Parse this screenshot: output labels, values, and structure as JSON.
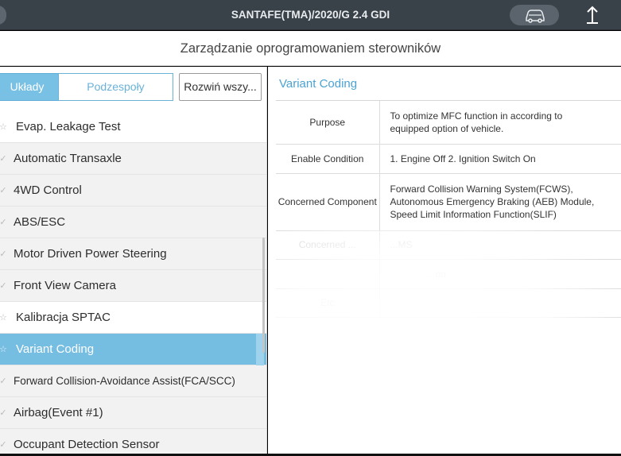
{
  "header": {
    "vehicle": "SANTAFE(TMA)/2020/G 2.4 GDI"
  },
  "subtitle": "Zarządzanie oprogramowaniem sterowników",
  "left_panel": {
    "segment_systems": "Układy",
    "segment_components": "Podzespoły",
    "expand_all": "Rozwiń wszy..."
  },
  "list": [
    {
      "label": "Evap. Leakage Test",
      "icon": "star-icon"
    },
    {
      "label": "Automatic Transaxle",
      "icon": "check-icon"
    },
    {
      "label": "4WD Control",
      "icon": "check-icon"
    },
    {
      "label": "ABS/ESC",
      "icon": "check-icon"
    },
    {
      "label": "Motor Driven Power Steering",
      "icon": "check-icon"
    },
    {
      "label": "Front View Camera",
      "icon": "check-icon"
    },
    {
      "label": "Kalibracja SPTAC",
      "icon": "star-icon"
    },
    {
      "label": "Variant Coding",
      "icon": "star-icon",
      "selected": true
    },
    {
      "label": "Forward Collision-Avoidance Assist(FCA/SCC)",
      "icon": "check-icon"
    },
    {
      "label": "Airbag(Event #1)",
      "icon": "check-icon"
    },
    {
      "label": "Occupant Detection Sensor",
      "icon": "check-icon"
    }
  ],
  "detail": {
    "title": "Variant Coding",
    "rows": [
      {
        "key": "Purpose",
        "value_lines": [
          "To optimize MFC function in according to",
          "equipped option of vehicle."
        ]
      },
      {
        "key": "Enable Condition",
        "value_lines": [
          "1. Engine Off 2. Ignition Switch On"
        ]
      },
      {
        "key": "Concerned Component",
        "value_lines": [
          "Forward Collision Warning System(FCWS),",
          "Autonomous Emergency Braking (AEB) Module,",
          "Speed Limit Information Function(SLIF)"
        ]
      }
    ],
    "faded_rows": [
      {
        "key": "Concerned ...",
        "value": "...MS"
      },
      {
        "key": "",
        "value": "...on"
      },
      {
        "key": "Etc",
        "value": ""
      }
    ]
  },
  "colors": {
    "topbar": "#3a4249",
    "accent": "#4aa3d3",
    "selected_row": "#76bde2"
  }
}
